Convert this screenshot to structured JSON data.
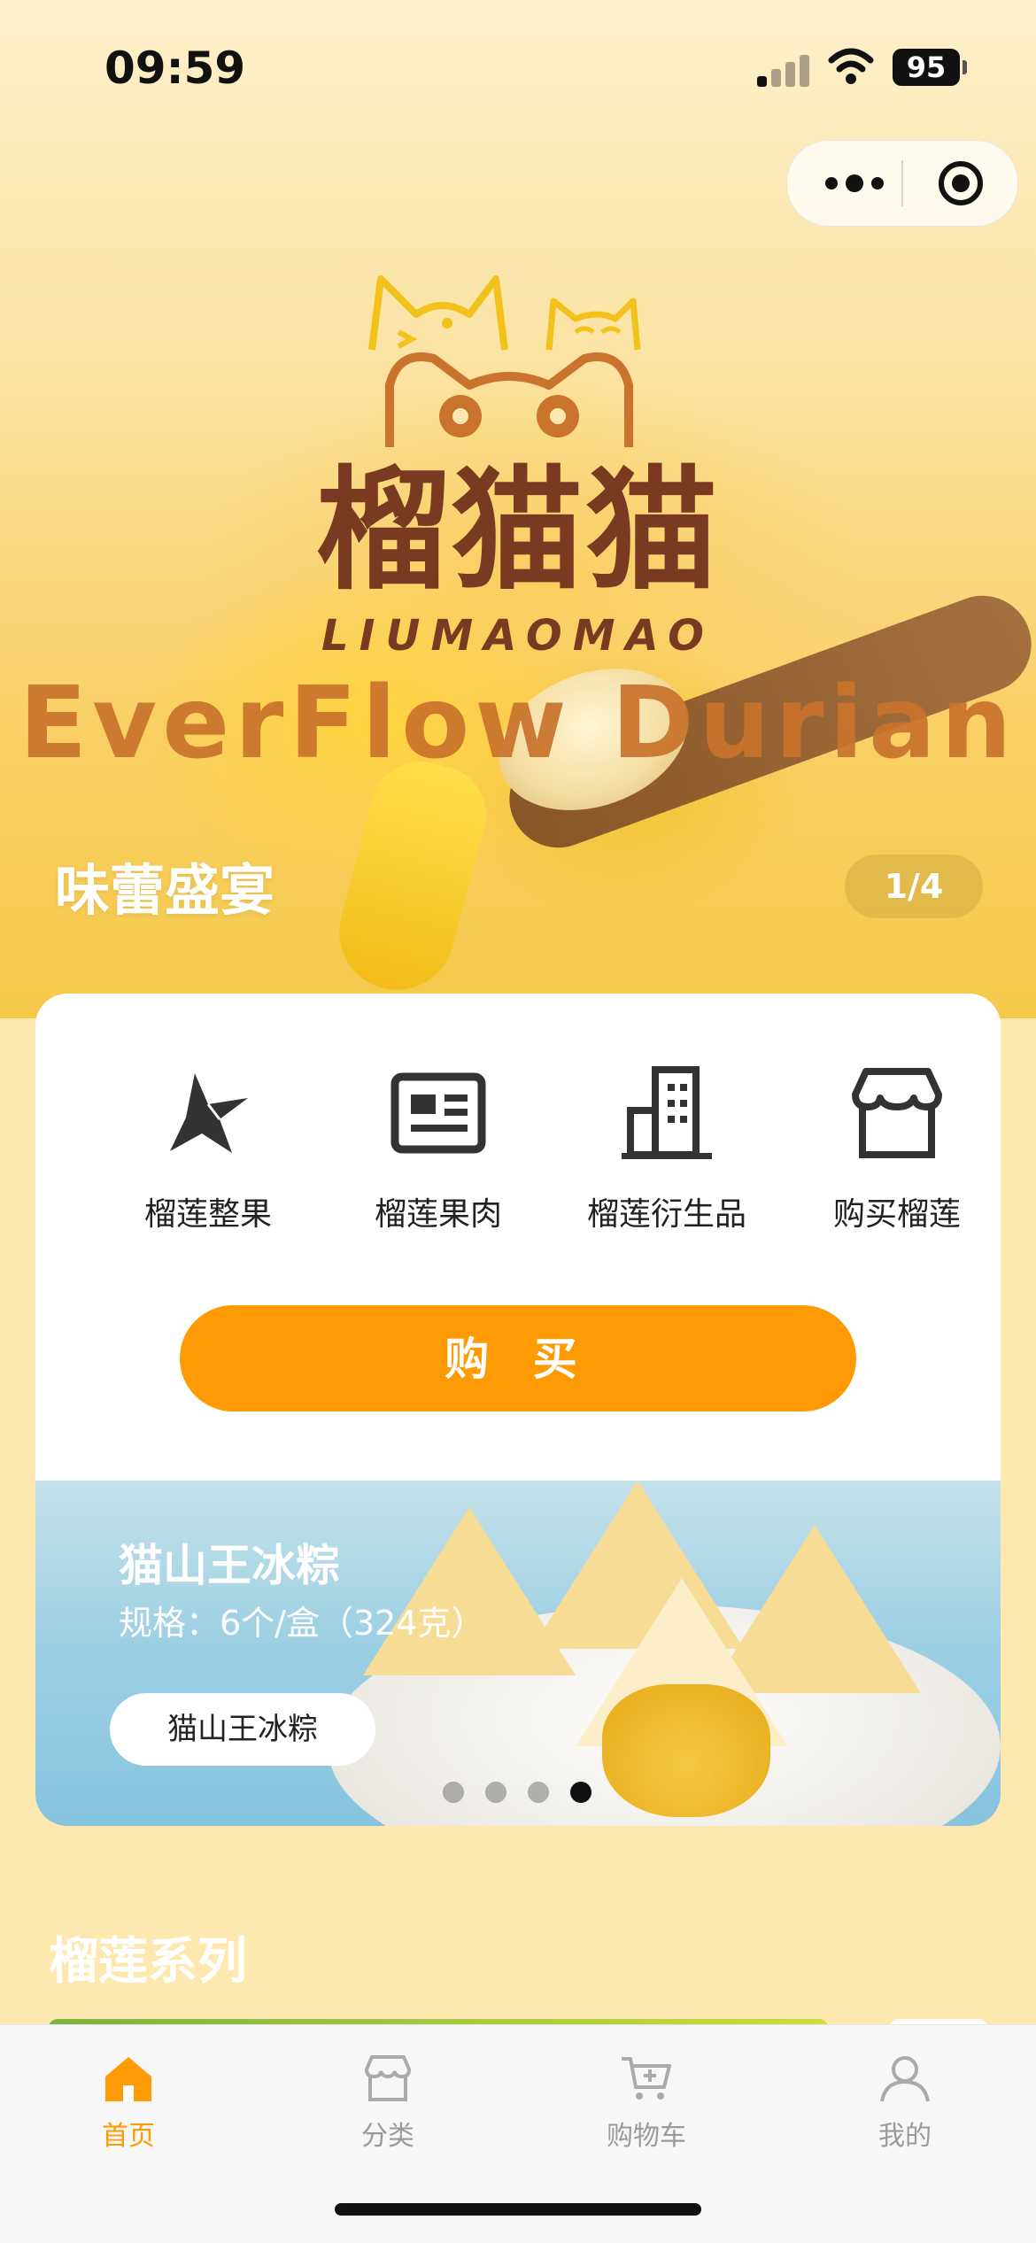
{
  "status_bar": {
    "time": "09:59",
    "battery": "95"
  },
  "hero": {
    "brand_cn": "榴猫猫",
    "brand_pinyin": "LIUMAOMAO",
    "brand_en": "EverFlow Durian",
    "section_title": "味蕾盛宴",
    "page_indicator": "1/4"
  },
  "categories": [
    {
      "label": "榴莲整果",
      "icon": "durian-icon"
    },
    {
      "label": "榴莲果肉",
      "icon": "card-icon"
    },
    {
      "label": "榴莲衍生品",
      "icon": "building-icon"
    },
    {
      "label": "购买榴莲",
      "icon": "store-icon"
    }
  ],
  "buy_button": "购 买",
  "banner": {
    "title": "猫山王冰粽",
    "spec": "规格：6个/盒（324克）",
    "tag": "猫山王冰粽",
    "slides": 4,
    "active_slide": 4
  },
  "series_title": "榴莲系列",
  "tabbar": [
    {
      "label": "首页",
      "icon": "home-icon",
      "active": true
    },
    {
      "label": "分类",
      "icon": "shop-icon",
      "active": false
    },
    {
      "label": "购物车",
      "icon": "cart-icon",
      "active": false
    },
    {
      "label": "我的",
      "icon": "user-icon",
      "active": false
    }
  ],
  "colors": {
    "accent": "#fe9a04",
    "brand_brown": "#7a3a22",
    "brand_orange": "#c9732c"
  }
}
